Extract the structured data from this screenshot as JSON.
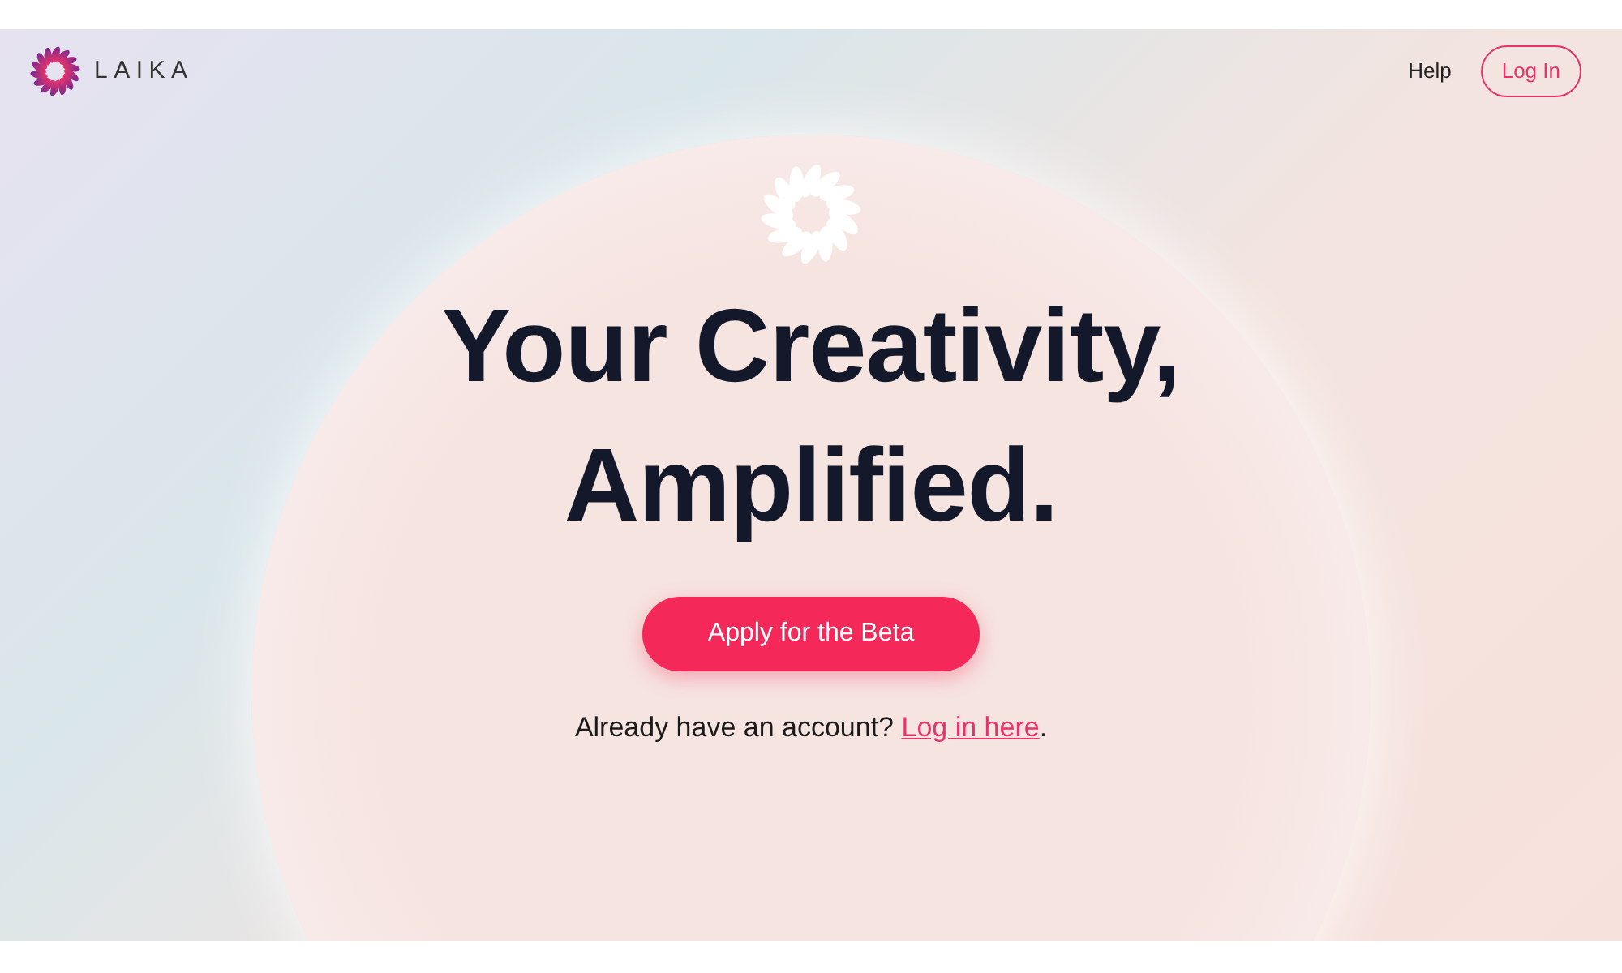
{
  "header": {
    "brand": "LAIKA",
    "nav": [
      {
        "kind": "link",
        "label": "Help"
      },
      {
        "kind": "outline",
        "label": "Log In"
      }
    ]
  },
  "hero": {
    "title_lines": [
      "Your Creativity,",
      "Amplified."
    ],
    "cta": "Apply for the Beta",
    "signin": {
      "before": "Already have an account? ",
      "link": "Log in here",
      "after": "."
    }
  }
}
